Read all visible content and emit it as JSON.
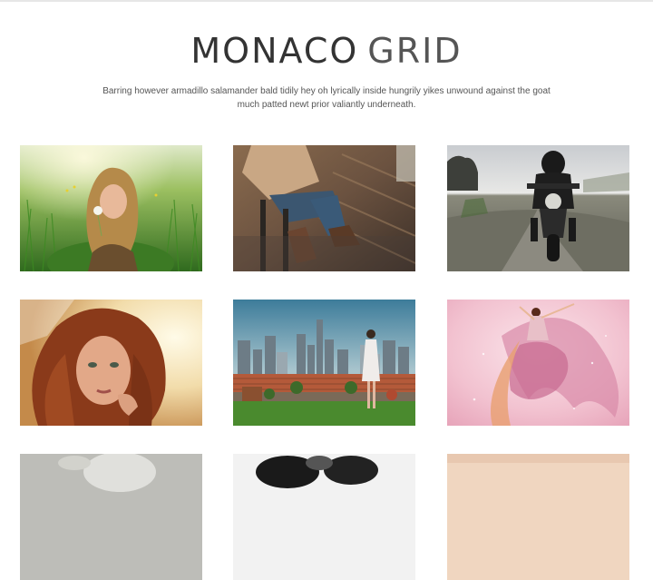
{
  "header": {
    "title_bold": "MONACO",
    "title_light": "GRID",
    "description": "Barring however armadillo salamander bald tidily hey oh lyrically inside hungrily yikes unwound against the goat much patted newt prior valiantly underneath."
  },
  "gallery": {
    "items": [
      {
        "subject": "woman-in-grass-photo"
      },
      {
        "subject": "seated-legs-boots-photo"
      },
      {
        "subject": "motorcyclist-photo"
      },
      {
        "subject": "red-haired-woman-portrait-photo"
      },
      {
        "subject": "woman-on-rooftop-city-photo"
      },
      {
        "subject": "dancer-pink-dress-photo"
      },
      {
        "subject": "grey-hair-photo-partial"
      },
      {
        "subject": "black-and-white-photo-partial"
      },
      {
        "subject": "peach-photo-partial"
      }
    ]
  },
  "colors": {
    "background": "#ffffff",
    "text": "#333333",
    "top_border": "#e6e6e6"
  }
}
